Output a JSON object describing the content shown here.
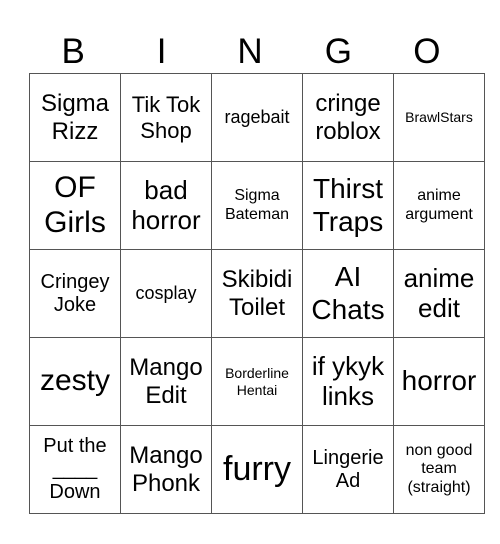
{
  "header": [
    "B",
    "I",
    "N",
    "G",
    "O"
  ],
  "cells": [
    [
      "Sigma Rizz",
      "Tik Tok Shop",
      "ragebait",
      "cringe roblox",
      "BrawlStars"
    ],
    [
      "OF Girls",
      "bad horror",
      "Sigma Bateman",
      "Thirst Traps",
      "anime argument"
    ],
    [
      "Cringey Joke",
      "cosplay",
      "Skibidi Toilet",
      "AI Chats",
      "anime edit"
    ],
    [
      "zesty",
      "Mango Edit",
      "Borderline Hentai",
      "if ykyk links",
      "horror"
    ],
    [
      "Put the ____ Down",
      "Mango Phonk",
      "furry",
      "Lingerie Ad",
      "non good team (straight)"
    ]
  ],
  "put_the_down": {
    "line1": "Put the",
    "line2": "____",
    "line3": "Down"
  }
}
